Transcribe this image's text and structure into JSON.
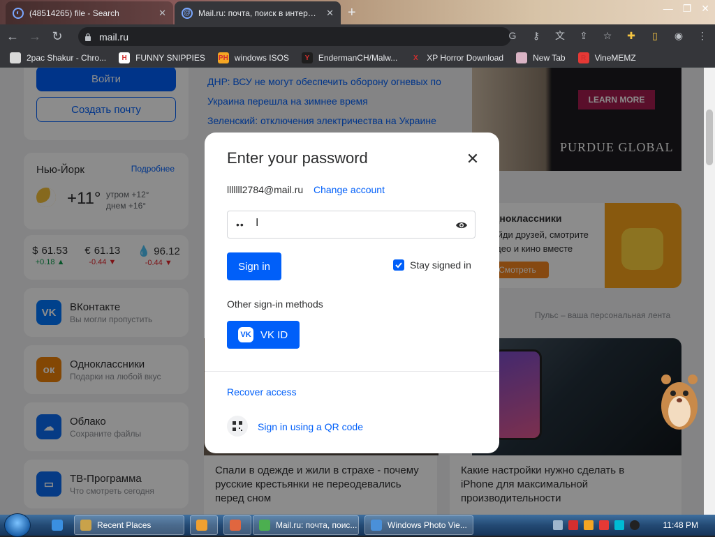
{
  "browser": {
    "inactive_tab_title": "(48514265) file - Search",
    "active_tab_title": "Mail.ru: почта, поиск в интерне",
    "url": "mail.ru"
  },
  "bookmarks": [
    {
      "label": "2pac Shakur - Chro...",
      "icon_color": "#d9d9d9",
      "icon_text": ""
    },
    {
      "label": "FUNNY SNIPPIES",
      "icon_color": "#ffffff",
      "icon_text": "H"
    },
    {
      "label": "windows ISOS",
      "icon_color": "#f5a623",
      "icon_text": "PH"
    },
    {
      "label": "EndermanCH/Malw...",
      "icon_color": "#1e1e1e",
      "icon_text": "Y"
    },
    {
      "label": "XP Horror Download",
      "icon_color": "#35363a",
      "icon_text": "X"
    },
    {
      "label": "New Tab",
      "icon_color": "#d9b3c4",
      "icon_text": ""
    },
    {
      "label": "VineMEMZ",
      "icon_color": "#e53935",
      "icon_text": "R"
    }
  ],
  "left": {
    "login_label": "Войти",
    "create_label": "Создать почту",
    "weather": {
      "city": "Нью-Йорк",
      "more": "Подробнее",
      "temp": "+11°",
      "morning": "утром +12°",
      "day": "днем +16°"
    },
    "rates": [
      {
        "symbol": "$",
        "value": "61.53",
        "delta": "+0.18 ▲",
        "dir": "up"
      },
      {
        "symbol": "€",
        "value": "61.13",
        "delta": "-0.44 ▼",
        "dir": "down"
      },
      {
        "symbol": "💧",
        "value": "96.12",
        "delta": "-0.44 ▼",
        "dir": "down"
      }
    ],
    "services": [
      {
        "name": "ВКонтакте",
        "sub": "Вы могли пропустить",
        "color": "#0077ff",
        "icon": "vk-icon",
        "glyph": "VK"
      },
      {
        "name": "Одноклассники",
        "sub": "Подарки на любой вкус",
        "color": "#ee8208",
        "icon": "ok-icon",
        "glyph": "ок"
      },
      {
        "name": "Облако",
        "sub": "Сохраните файлы",
        "color": "#0c6cf2",
        "icon": "cloud-icon",
        "glyph": "☁"
      },
      {
        "name": "ТВ-Программа",
        "sub": "Что смотреть сегодня",
        "color": "#0c6cf2",
        "icon": "tv-icon",
        "glyph": "▭"
      }
    ]
  },
  "news": [
    "ДНР: ВСУ не могут обеспечить оборону огневых по",
    "Украина перешла на зимнее время",
    "Зеленский: отключения электричества на Украине"
  ],
  "ads": {
    "learn_more": "LEARN MORE",
    "brand": "PURDUE GLOBAL",
    "ok_title": "Одноклассники",
    "ok_text": "Найди друзей, смотрите видео и кино вместе",
    "ok_btn": "Смотреть"
  },
  "pulse": "Пульс – ваша персональная лента",
  "articles": {
    "left": "Спали в одежде и жили в страхе - почему русские крестьянки не переодевались перед сном",
    "right": "Какие настройки нужно сделать в iPhone для максимальной производительности"
  },
  "modal": {
    "title": "Enter your password",
    "account": "lllllll2784@mail.ru",
    "change_account": "Change account",
    "password_value": "••",
    "signin_label": "Sign in",
    "stay_signed": "Stay signed in",
    "other_methods": "Other sign-in methods",
    "vkid_label": "VK ID",
    "recover": "Recover access",
    "qr_label": "Sign in using a QR code"
  },
  "taskbar": {
    "items": [
      {
        "label": "Recent Places",
        "icon_color": "#c9a24a"
      },
      {
        "label": "",
        "icon_color": "#f0a030"
      },
      {
        "label": "",
        "icon_color": "#e0663f"
      },
      {
        "label": "Mail.ru: почта, поис...",
        "icon_color": "#4caf50"
      },
      {
        "label": "Windows Photo Vie...",
        "icon_color": "#4a90d9"
      }
    ],
    "clock": "11:48 PM"
  }
}
